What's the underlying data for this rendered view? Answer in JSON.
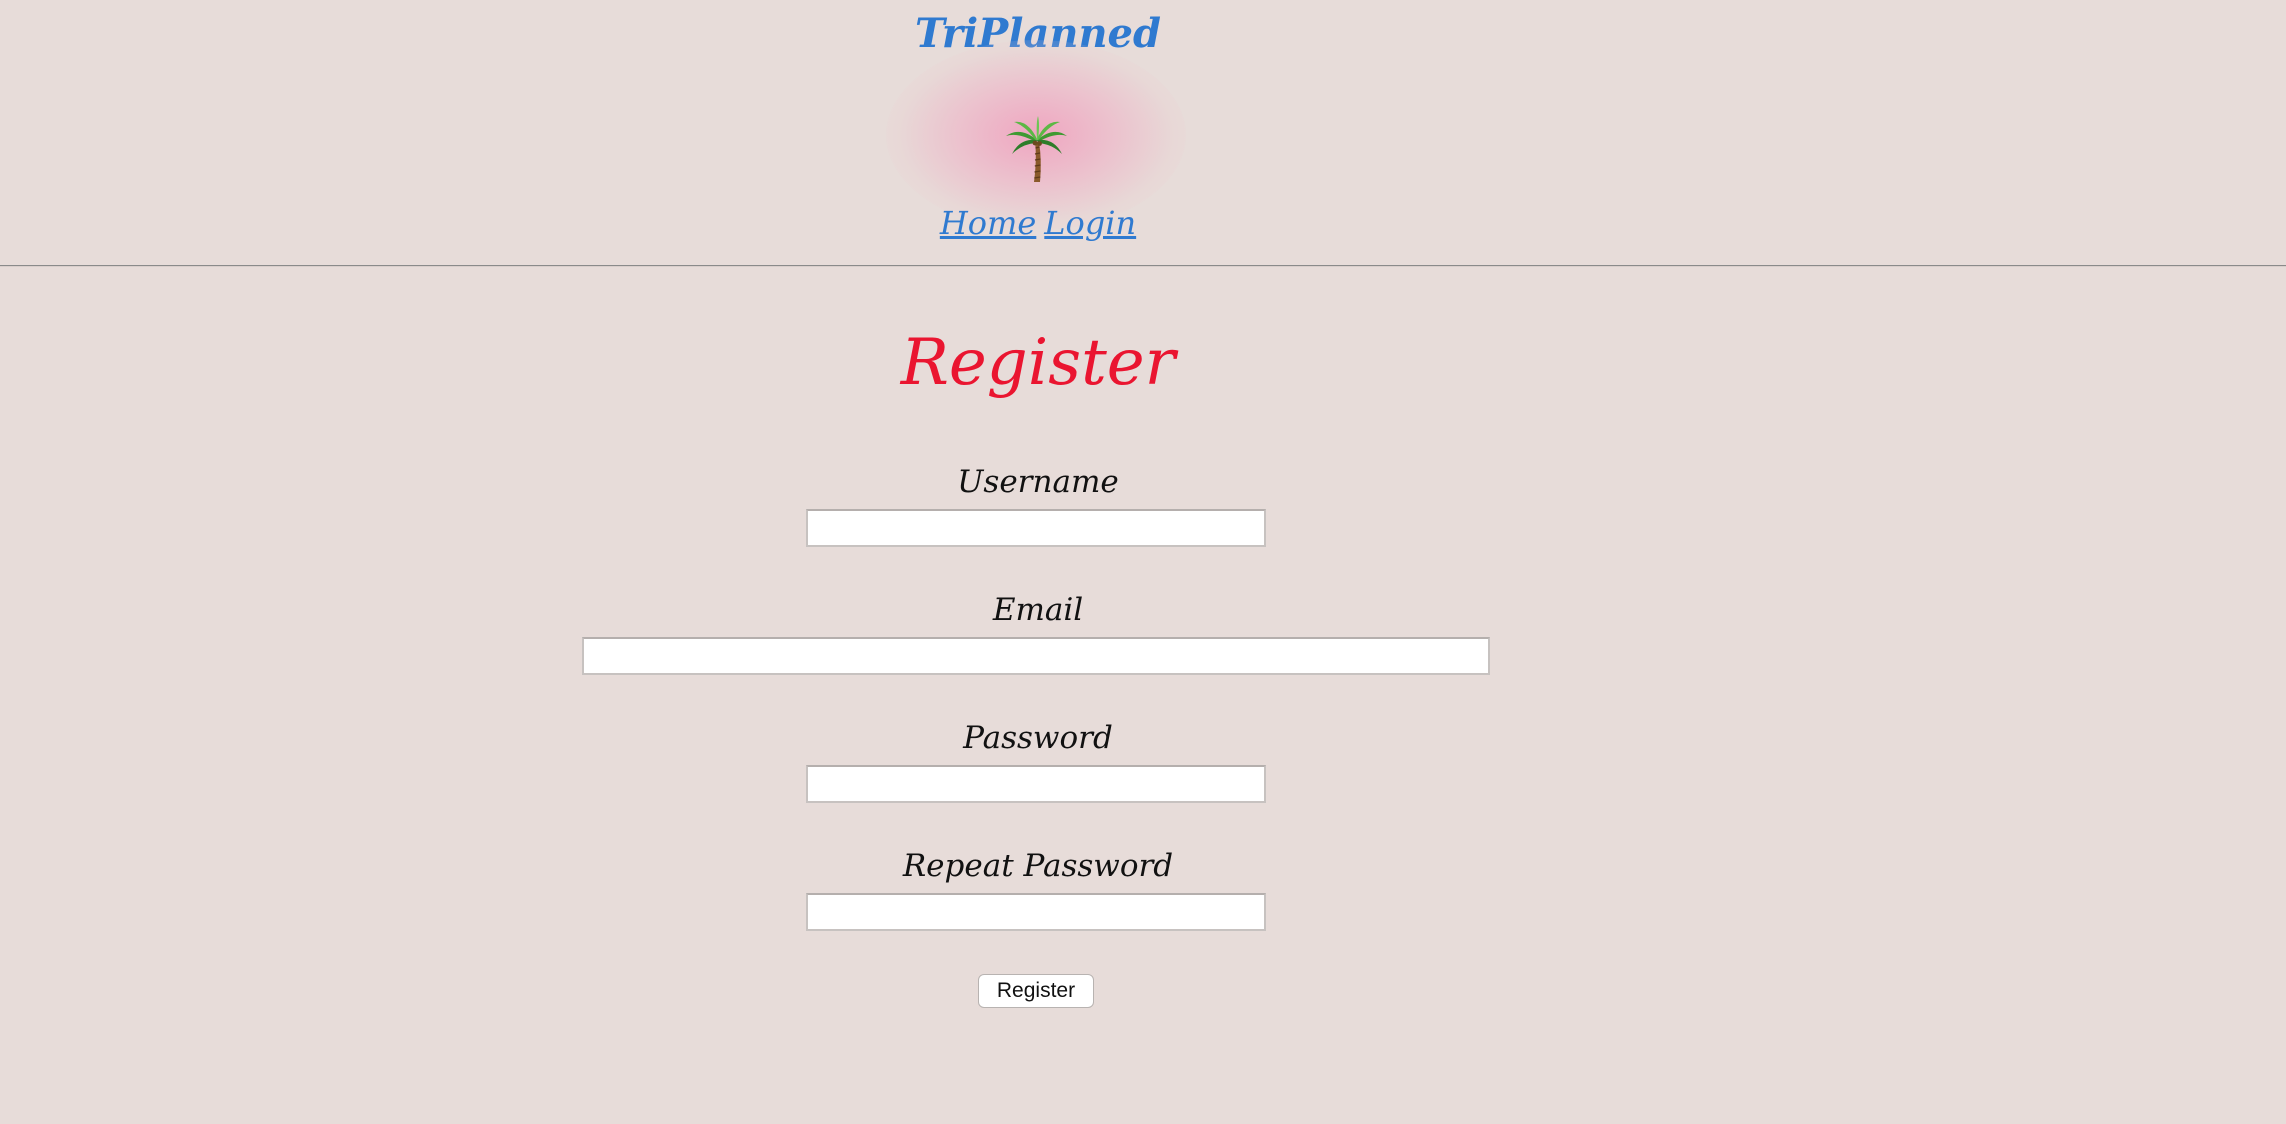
{
  "header": {
    "site_title": "TriPlanned",
    "logo_icon": "palm-tree-icon",
    "nav": {
      "home_label": "Home",
      "login_label": "Login"
    }
  },
  "main": {
    "heading": "Register",
    "fields": {
      "username": {
        "label": "Username",
        "value": "",
        "placeholder": ""
      },
      "email": {
        "label": "Email",
        "value": "",
        "placeholder": ""
      },
      "password": {
        "label": "Password",
        "value": "",
        "placeholder": ""
      },
      "repeat_password": {
        "label": "Repeat Password",
        "value": "",
        "placeholder": ""
      }
    },
    "submit_label": "Register"
  },
  "colors": {
    "background": "#e7dcd9",
    "link_blue": "#2f7ad0",
    "heading_red": "#ea1530",
    "logo_glow_pink": "#f0a0be"
  }
}
